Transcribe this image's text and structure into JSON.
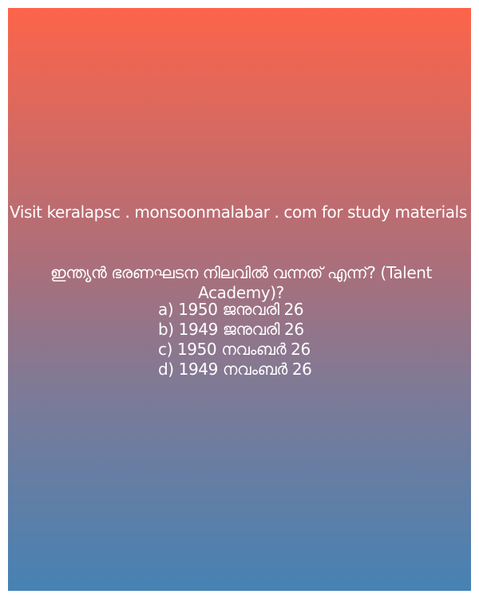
{
  "promo_text": "Visit keralapsc . monsoonmalabar . com for study materials",
  "question": "ഇന്ത്യൻ ഭരണഘടന നിലവിൽ വന്നത് എന്ന്? (Talent Academy)?",
  "options": [
    "a) 1950 ജനുവരി 26",
    "b) 1949 ജനുവരി 26",
    "c) 1950 നവംബർ 26",
    "d) 1949 നവംബർ 26"
  ]
}
